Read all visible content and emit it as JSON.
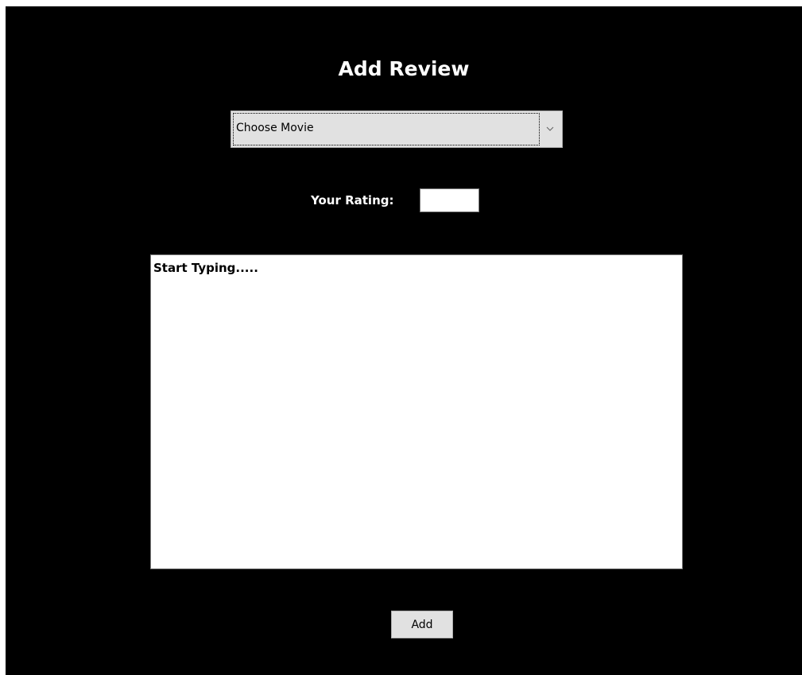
{
  "form": {
    "title": "Add Review",
    "movie_select": {
      "selected": "Choose Movie"
    },
    "rating": {
      "label": "Your Rating:",
      "value": ""
    },
    "review": {
      "value": "Start Typing....."
    },
    "add_button_label": "Add"
  },
  "colors": {
    "background": "#000000",
    "text": "#ffffff",
    "control_face": "#e1e1e1"
  },
  "icons": {
    "dropdown": "chevron-down-icon"
  }
}
